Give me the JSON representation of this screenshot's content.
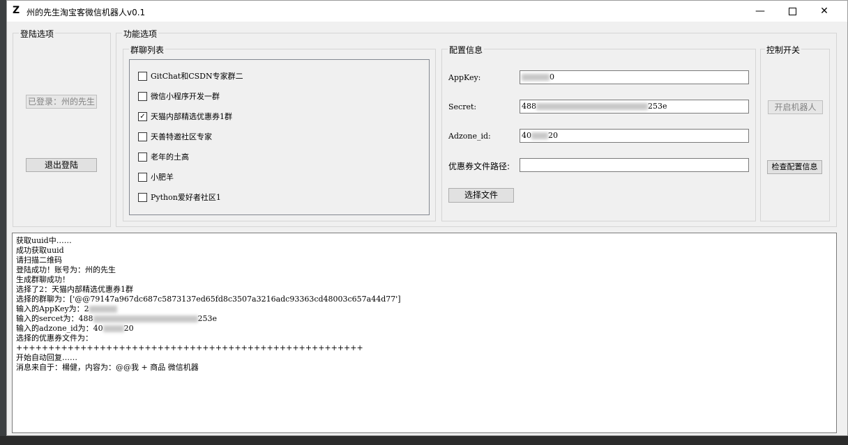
{
  "window": {
    "title": "州的先生淘宝客微信机器人v0.1",
    "icon_glyph": "Z",
    "min_glyph": "—",
    "close_glyph": "✕"
  },
  "login": {
    "group_title": "登陆选项",
    "logged_in_label": "已登录：州的先生",
    "logout_label": "退出登陆"
  },
  "features": {
    "group_title": "功能选项",
    "group_chat": {
      "title": "群聊列表",
      "items": [
        {
          "label": "GitChat和CSDN专家群二",
          "checked": false
        },
        {
          "label": "微信小程序开发一群",
          "checked": false
        },
        {
          "label": "天猫内部精选优惠券1群",
          "checked": true
        },
        {
          "label": "天善特邀社区专家",
          "checked": false
        },
        {
          "label": "老年的土高",
          "checked": false
        },
        {
          "label": "小肥羊",
          "checked": false
        },
        {
          "label": "Python爱好者社区1",
          "checked": false
        }
      ]
    },
    "config": {
      "title": "配置信息",
      "appkey_label": "AppKey:",
      "appkey_prefix": "",
      "appkey_suffix": "0",
      "secret_label": "Secret:",
      "secret_prefix": "488",
      "secret_suffix": "253e",
      "adzone_label": "Adzone_id:",
      "adzone_prefix": "40",
      "adzone_suffix": "20",
      "coupon_label": "优惠券文件路径:",
      "coupon_value": "",
      "choose_file_label": "选择文件"
    },
    "control": {
      "title": "控制开关",
      "start_label": "开启机器人",
      "check_label": "检查配置信息"
    }
  },
  "log": [
    "获取uuid中……",
    "成功获取uuid",
    "请扫描二维码",
    "登陆成功！账号为：州的先生",
    "生成群聊成功！",
    "选择了2：天猫内部精选优惠券1群",
    "选择的群聊为：['@@79147a967dc687c5873137ed65fd8c3507a3216adc93363cd48003c657a44d77']",
    "输入的AppKey为：2",
    "输入的sercet为：488",
    "输入的adzone_id为：40",
    "选择的优惠券文件为：",
    "++++++++++++++++++++++++++++++++++++++++++++++++++++++",
    "开始自动回复……",
    "消息来自于：楊健，内容为：@@我 + 商品 微信机器"
  ]
}
